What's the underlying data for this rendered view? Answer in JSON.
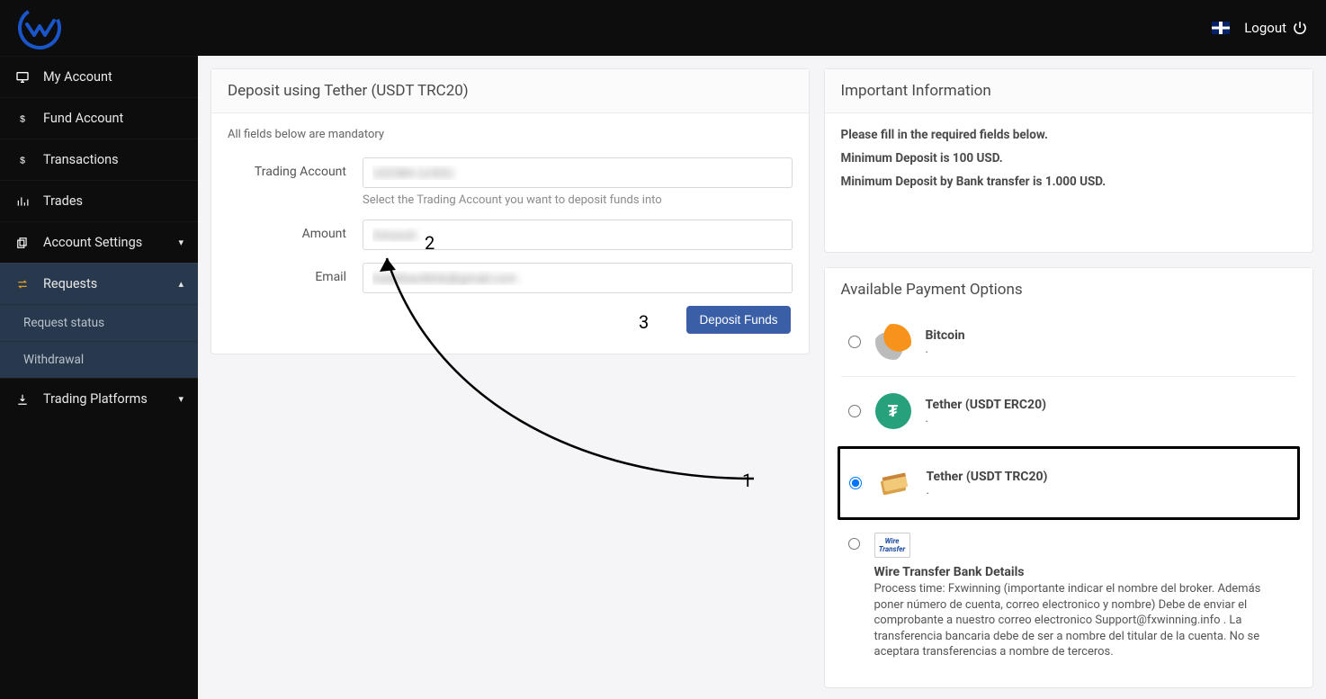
{
  "header": {
    "logout_label": "Logout"
  },
  "sidebar": {
    "items": [
      {
        "icon": "monitor",
        "label": "My Account"
      },
      {
        "icon": "dollar",
        "label": "Fund Account"
      },
      {
        "icon": "dollar",
        "label": "Transactions"
      },
      {
        "icon": "bars",
        "label": "Trades"
      },
      {
        "icon": "copy",
        "label": "Account Settings",
        "chev": "down"
      },
      {
        "icon": "exchange",
        "label": "Requests",
        "chev": "up",
        "open": true,
        "subs": [
          {
            "label": "Request status"
          },
          {
            "label": "Withdrawal"
          }
        ]
      },
      {
        "icon": "download",
        "label": "Trading Platforms",
        "chev": "down"
      }
    ]
  },
  "deposit": {
    "title": "Deposit using Tether (USDT TRC20)",
    "mandatory_note": "All fields below are mandatory",
    "labels": {
      "trading_account": "Trading Account",
      "trading_account_hint": "Select the Trading Account you want to deposit funds into",
      "amount": "Amount",
      "email": "Email"
    },
    "values": {
      "trading_account": "102384 (USD)",
      "amount": "Amount",
      "email": "tradebacklink@gmail.com"
    },
    "button": "Deposit Funds"
  },
  "info": {
    "title": "Important Information",
    "lines": [
      "Please fill in the required fields below.",
      "Minimum Deposit is 100 USD.",
      "Minimum Deposit by Bank transfer is 1.000 USD."
    ]
  },
  "payments": {
    "title": "Available Payment Options",
    "options": [
      {
        "id": "bitcoin",
        "title": "Bitcoin",
        "sub": "."
      },
      {
        "id": "usdt-erc20",
        "title": "Tether (USDT ERC20)",
        "sub": "."
      },
      {
        "id": "usdt-trc20",
        "title": "Tether (USDT TRC20)",
        "sub": ".",
        "selected": true
      },
      {
        "id": "wire",
        "title": "Wire Transfer Bank Details",
        "sub": "Process time: Fxwinning (importante indicar el nombre del broker. Además poner número de cuenta, correo electronico y nombre) Debe de enviar el comprobante a nuestro correo electronico Support@fxwinning.info . La transferencia bancaria debe de ser a nombre del titular de la cuenta. No se aceptara transferencias a nombre de terceros."
      }
    ]
  },
  "annotations": {
    "n1": "1",
    "n2": "2",
    "n3": "3"
  }
}
